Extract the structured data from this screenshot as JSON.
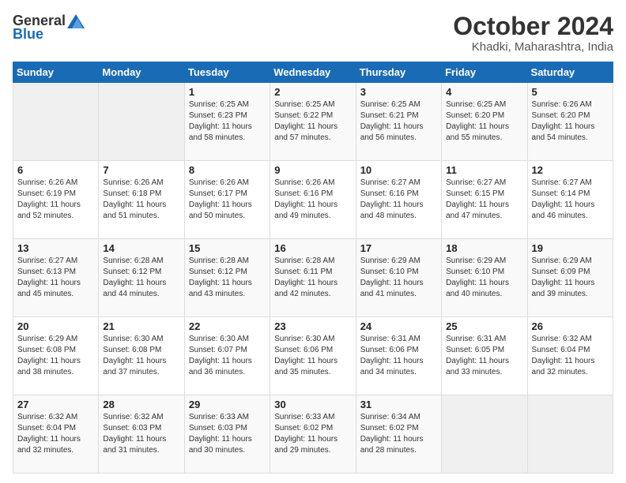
{
  "header": {
    "logo_line1": "General",
    "logo_line2": "Blue",
    "month_title": "October 2024",
    "subtitle": "Khadki, Maharashtra, India"
  },
  "weekdays": [
    "Sunday",
    "Monday",
    "Tuesday",
    "Wednesday",
    "Thursday",
    "Friday",
    "Saturday"
  ],
  "weeks": [
    [
      {
        "day": "",
        "sunrise": "",
        "sunset": "",
        "daylight": ""
      },
      {
        "day": "",
        "sunrise": "",
        "sunset": "",
        "daylight": ""
      },
      {
        "day": "1",
        "sunrise": "Sunrise: 6:25 AM",
        "sunset": "Sunset: 6:23 PM",
        "daylight": "Daylight: 11 hours and 58 minutes."
      },
      {
        "day": "2",
        "sunrise": "Sunrise: 6:25 AM",
        "sunset": "Sunset: 6:22 PM",
        "daylight": "Daylight: 11 hours and 57 minutes."
      },
      {
        "day": "3",
        "sunrise": "Sunrise: 6:25 AM",
        "sunset": "Sunset: 6:21 PM",
        "daylight": "Daylight: 11 hours and 56 minutes."
      },
      {
        "day": "4",
        "sunrise": "Sunrise: 6:25 AM",
        "sunset": "Sunset: 6:20 PM",
        "daylight": "Daylight: 11 hours and 55 minutes."
      },
      {
        "day": "5",
        "sunrise": "Sunrise: 6:26 AM",
        "sunset": "Sunset: 6:20 PM",
        "daylight": "Daylight: 11 hours and 54 minutes."
      }
    ],
    [
      {
        "day": "6",
        "sunrise": "Sunrise: 6:26 AM",
        "sunset": "Sunset: 6:19 PM",
        "daylight": "Daylight: 11 hours and 52 minutes."
      },
      {
        "day": "7",
        "sunrise": "Sunrise: 6:26 AM",
        "sunset": "Sunset: 6:18 PM",
        "daylight": "Daylight: 11 hours and 51 minutes."
      },
      {
        "day": "8",
        "sunrise": "Sunrise: 6:26 AM",
        "sunset": "Sunset: 6:17 PM",
        "daylight": "Daylight: 11 hours and 50 minutes."
      },
      {
        "day": "9",
        "sunrise": "Sunrise: 6:26 AM",
        "sunset": "Sunset: 6:16 PM",
        "daylight": "Daylight: 11 hours and 49 minutes."
      },
      {
        "day": "10",
        "sunrise": "Sunrise: 6:27 AM",
        "sunset": "Sunset: 6:16 PM",
        "daylight": "Daylight: 11 hours and 48 minutes."
      },
      {
        "day": "11",
        "sunrise": "Sunrise: 6:27 AM",
        "sunset": "Sunset: 6:15 PM",
        "daylight": "Daylight: 11 hours and 47 minutes."
      },
      {
        "day": "12",
        "sunrise": "Sunrise: 6:27 AM",
        "sunset": "Sunset: 6:14 PM",
        "daylight": "Daylight: 11 hours and 46 minutes."
      }
    ],
    [
      {
        "day": "13",
        "sunrise": "Sunrise: 6:27 AM",
        "sunset": "Sunset: 6:13 PM",
        "daylight": "Daylight: 11 hours and 45 minutes."
      },
      {
        "day": "14",
        "sunrise": "Sunrise: 6:28 AM",
        "sunset": "Sunset: 6:12 PM",
        "daylight": "Daylight: 11 hours and 44 minutes."
      },
      {
        "day": "15",
        "sunrise": "Sunrise: 6:28 AM",
        "sunset": "Sunset: 6:12 PM",
        "daylight": "Daylight: 11 hours and 43 minutes."
      },
      {
        "day": "16",
        "sunrise": "Sunrise: 6:28 AM",
        "sunset": "Sunset: 6:11 PM",
        "daylight": "Daylight: 11 hours and 42 minutes."
      },
      {
        "day": "17",
        "sunrise": "Sunrise: 6:29 AM",
        "sunset": "Sunset: 6:10 PM",
        "daylight": "Daylight: 11 hours and 41 minutes."
      },
      {
        "day": "18",
        "sunrise": "Sunrise: 6:29 AM",
        "sunset": "Sunset: 6:10 PM",
        "daylight": "Daylight: 11 hours and 40 minutes."
      },
      {
        "day": "19",
        "sunrise": "Sunrise: 6:29 AM",
        "sunset": "Sunset: 6:09 PM",
        "daylight": "Daylight: 11 hours and 39 minutes."
      }
    ],
    [
      {
        "day": "20",
        "sunrise": "Sunrise: 6:29 AM",
        "sunset": "Sunset: 6:08 PM",
        "daylight": "Daylight: 11 hours and 38 minutes."
      },
      {
        "day": "21",
        "sunrise": "Sunrise: 6:30 AM",
        "sunset": "Sunset: 6:08 PM",
        "daylight": "Daylight: 11 hours and 37 minutes."
      },
      {
        "day": "22",
        "sunrise": "Sunrise: 6:30 AM",
        "sunset": "Sunset: 6:07 PM",
        "daylight": "Daylight: 11 hours and 36 minutes."
      },
      {
        "day": "23",
        "sunrise": "Sunrise: 6:30 AM",
        "sunset": "Sunset: 6:06 PM",
        "daylight": "Daylight: 11 hours and 35 minutes."
      },
      {
        "day": "24",
        "sunrise": "Sunrise: 6:31 AM",
        "sunset": "Sunset: 6:06 PM",
        "daylight": "Daylight: 11 hours and 34 minutes."
      },
      {
        "day": "25",
        "sunrise": "Sunrise: 6:31 AM",
        "sunset": "Sunset: 6:05 PM",
        "daylight": "Daylight: 11 hours and 33 minutes."
      },
      {
        "day": "26",
        "sunrise": "Sunrise: 6:32 AM",
        "sunset": "Sunset: 6:04 PM",
        "daylight": "Daylight: 11 hours and 32 minutes."
      }
    ],
    [
      {
        "day": "27",
        "sunrise": "Sunrise: 6:32 AM",
        "sunset": "Sunset: 6:04 PM",
        "daylight": "Daylight: 11 hours and 32 minutes."
      },
      {
        "day": "28",
        "sunrise": "Sunrise: 6:32 AM",
        "sunset": "Sunset: 6:03 PM",
        "daylight": "Daylight: 11 hours and 31 minutes."
      },
      {
        "day": "29",
        "sunrise": "Sunrise: 6:33 AM",
        "sunset": "Sunset: 6:03 PM",
        "daylight": "Daylight: 11 hours and 30 minutes."
      },
      {
        "day": "30",
        "sunrise": "Sunrise: 6:33 AM",
        "sunset": "Sunset: 6:02 PM",
        "daylight": "Daylight: 11 hours and 29 minutes."
      },
      {
        "day": "31",
        "sunrise": "Sunrise: 6:34 AM",
        "sunset": "Sunset: 6:02 PM",
        "daylight": "Daylight: 11 hours and 28 minutes."
      },
      {
        "day": "",
        "sunrise": "",
        "sunset": "",
        "daylight": ""
      },
      {
        "day": "",
        "sunrise": "",
        "sunset": "",
        "daylight": ""
      }
    ]
  ]
}
